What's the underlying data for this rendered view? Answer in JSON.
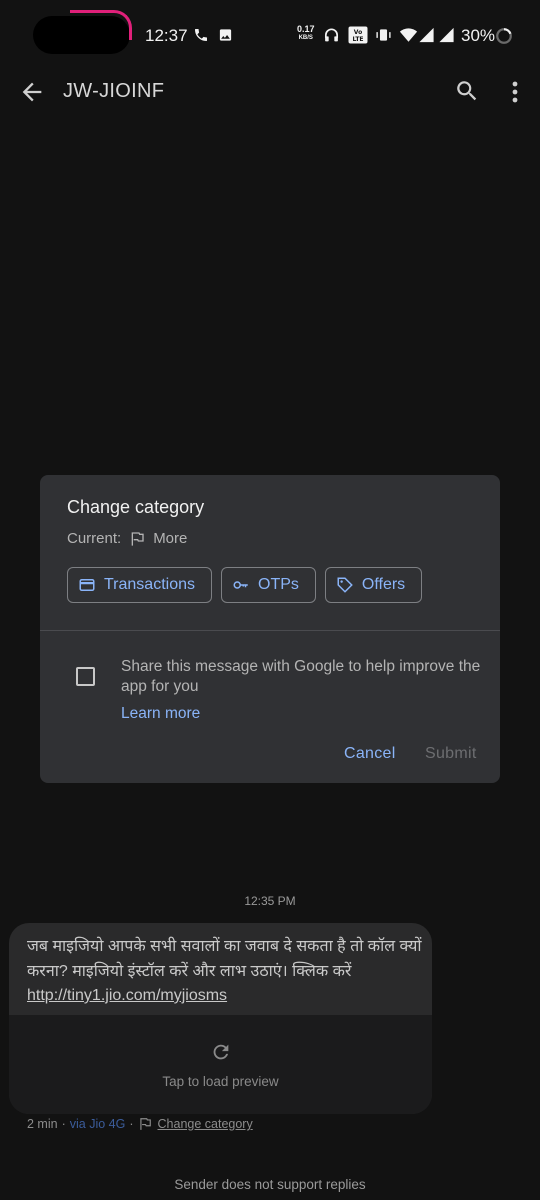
{
  "status_bar": {
    "time": "12:37",
    "net_speed_value": "0.17",
    "net_speed_unit": "KB/S",
    "volte": "VoLTE",
    "battery": "30%",
    "icons": [
      "phone-icon",
      "image-icon",
      "headphones-icon",
      "volte-icon",
      "vibrate-icon",
      "wifi-icon",
      "signal-icon",
      "battery-icon"
    ]
  },
  "app_bar": {
    "title": "JW-JIOINF",
    "icons": [
      "back-arrow-icon",
      "search-icon",
      "more-vert-icon"
    ]
  },
  "dialog": {
    "title": "Change category",
    "current_label": "Current:",
    "current_value": "More",
    "chips": [
      {
        "label": "Transactions",
        "icon": "card-icon"
      },
      {
        "label": "OTPs",
        "icon": "key-icon"
      },
      {
        "label": "Offers",
        "icon": "tag-icon"
      }
    ],
    "share_text": "Share this message with Google to help improve the app for you",
    "share_checked": false,
    "learn_more": "Learn more",
    "cancel": "Cancel",
    "submit": "Submit"
  },
  "conversation": {
    "timestamp": "12:35 PM",
    "message_text": "जब माइजियो आपके सभी सवालों का जवाब दे सकता है तो कॉल क्यों करना? माइजियो इंस्टॉल करें और लाभ उठाएं। क्लिक करें ",
    "message_link": "http://tiny1.jio.com/myjiosms",
    "preview_text": "Tap to load preview",
    "meta_age": "2 min",
    "meta_via": "via Jio 4G",
    "meta_change_category": "Change category",
    "footer": "Sender does not support replies"
  },
  "colors": {
    "background": "#121212",
    "dialog": "#303134",
    "accent": "#8ab4f8",
    "bubble": "#2a2a2b"
  }
}
